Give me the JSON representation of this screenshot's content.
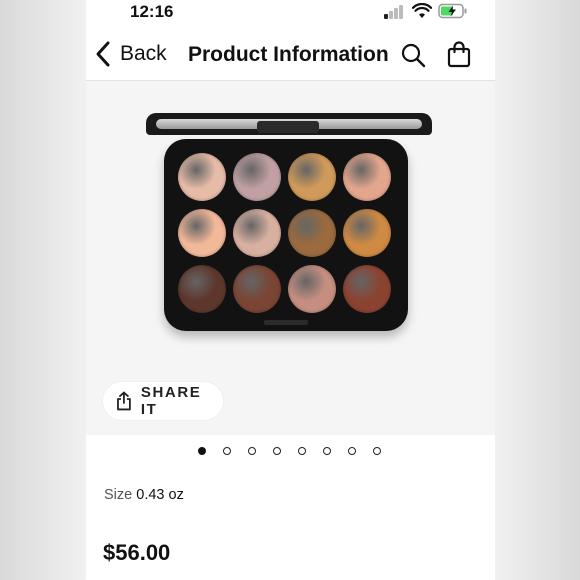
{
  "status_bar": {
    "time": "12:16"
  },
  "nav": {
    "back_label": "Back",
    "title": "Product Information",
    "icons": [
      "chevron-left-icon",
      "search-icon",
      "shopping-bag-icon"
    ]
  },
  "product": {
    "image_alt_icon": "eyeshadow-palette",
    "shade_colors": [
      "#e6bba7",
      "#c0a0a2",
      "#d09a5a",
      "#e3a58c",
      "#f2b89a",
      "#d8b0a0",
      "#9b6a3e",
      "#cf8a43",
      "#5e372c",
      "#7a4534",
      "#c58e80",
      "#8b4331"
    ],
    "share_label": "SHARE IT",
    "gallery": {
      "total": 8,
      "active_index": 0
    },
    "size_label": "Size",
    "size_value": "0.43 oz",
    "price": "$56.00"
  },
  "colors": {
    "accent": "#111111",
    "background": "#ffffff",
    "battery_green": "#4cd964"
  }
}
